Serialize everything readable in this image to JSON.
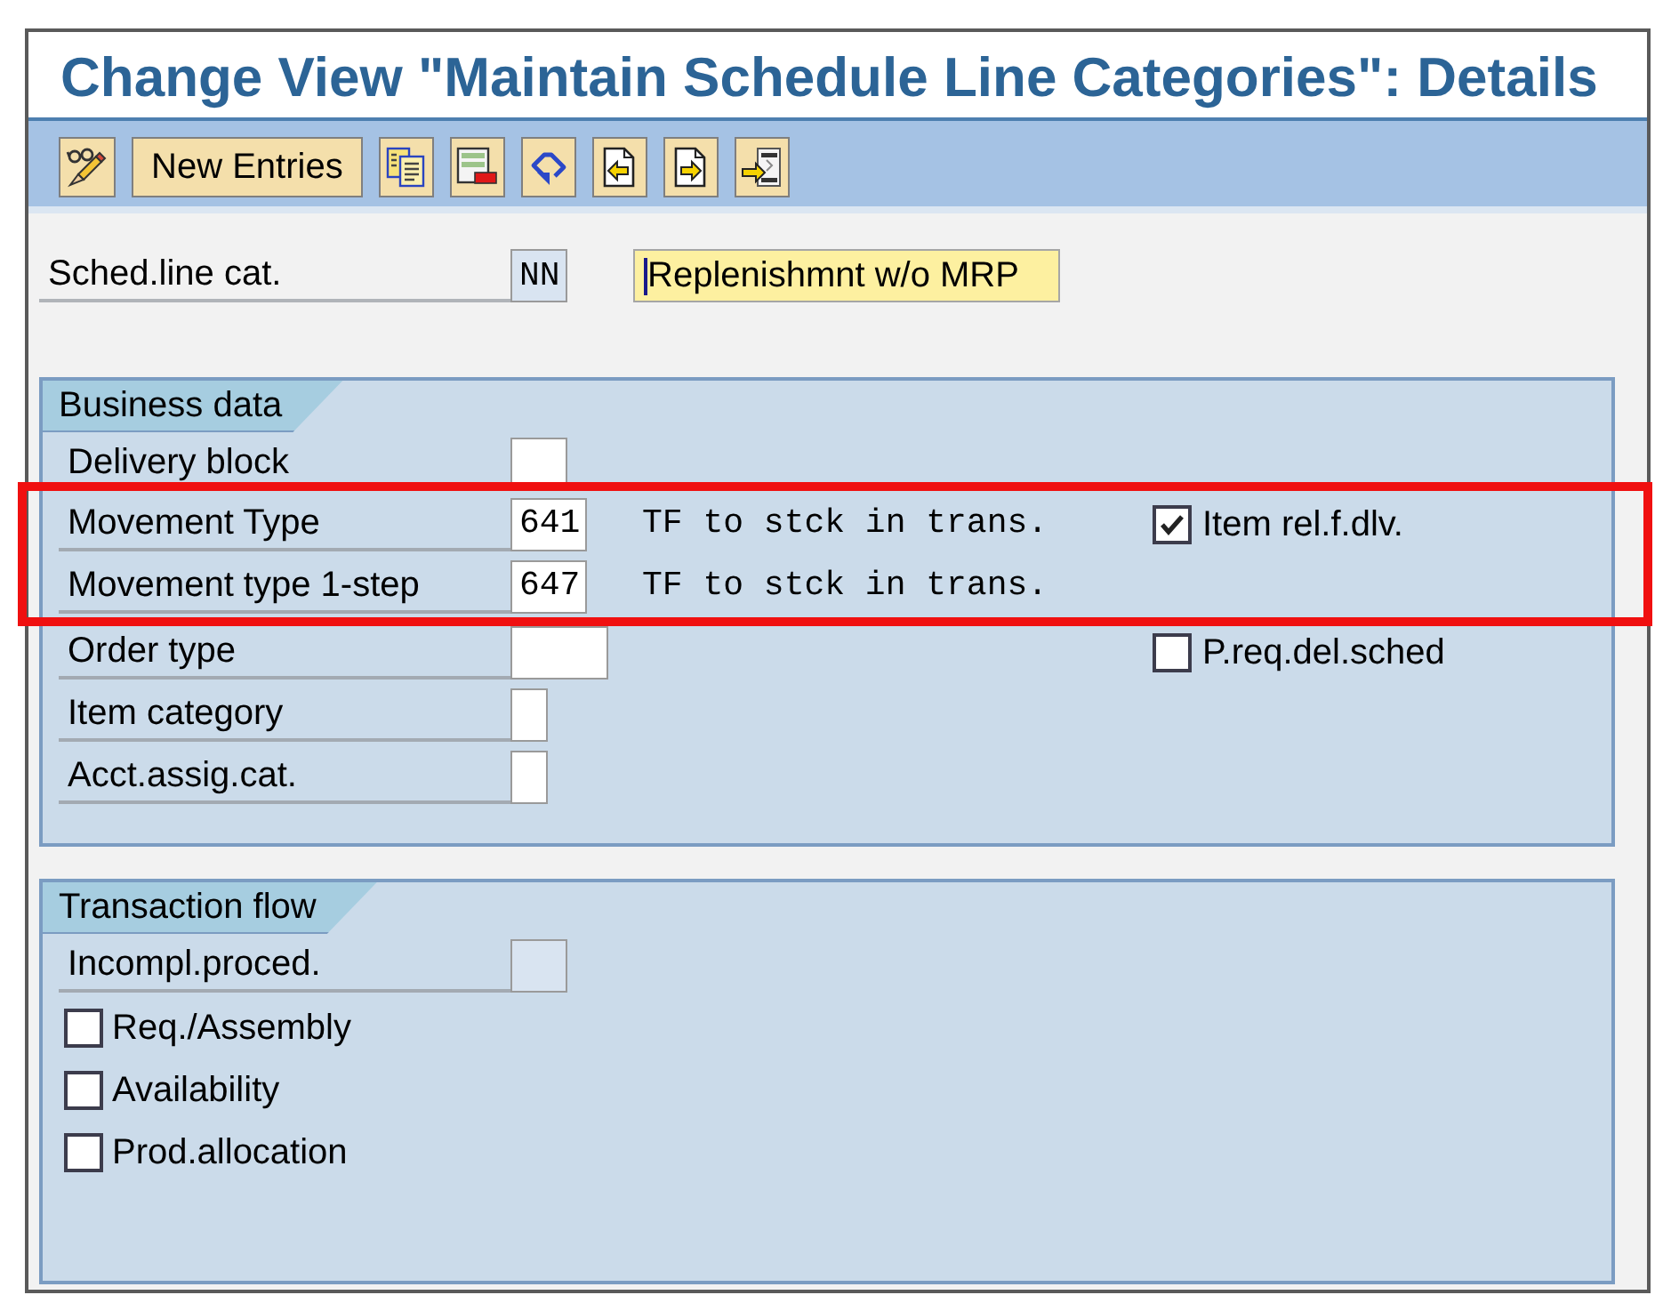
{
  "title": "Change View \"Maintain Schedule Line Categories\": Details",
  "toolbar": [
    {
      "kind": "icon"
    },
    {
      "kind": "text",
      "label": "New Entries"
    },
    {
      "kind": "icon"
    },
    {
      "kind": "icon"
    },
    {
      "kind": "icon"
    },
    {
      "kind": "icon"
    },
    {
      "kind": "icon"
    },
    {
      "kind": "icon"
    }
  ],
  "header_field": {
    "label": "Sched.line cat.",
    "value": "NN",
    "editable": false,
    "description": {
      "value": "Replenishmnt w/o MRP",
      "focused": true
    }
  },
  "groups": [
    {
      "title": "Business data",
      "rows": [
        {
          "kind": "field",
          "label": "Delivery block",
          "editable": true,
          "highlighted": false
        },
        {
          "kind": "field",
          "label": "Movement Type",
          "value": "641",
          "editable": true,
          "text": "TF to stck in trans.",
          "highlighted": true,
          "checkbox": {
            "label": "Item rel.f.dlv.",
            "checked": true
          }
        },
        {
          "kind": "field",
          "label": "Movement type 1-step",
          "value": "647",
          "editable": true,
          "text": "TF to stck in trans.",
          "highlighted": true
        },
        {
          "kind": "field",
          "label": "Order type",
          "editable": true,
          "highlighted": false,
          "checkbox": {
            "label": "P.req.del.sched",
            "checked": false
          }
        },
        {
          "kind": "field",
          "label": "Item category",
          "editable": true,
          "highlighted": false
        },
        {
          "kind": "field",
          "label": "Acct.assig.cat.",
          "editable": true,
          "highlighted": false
        }
      ]
    },
    {
      "title": "Transaction flow",
      "rows": [
        {
          "kind": "field",
          "label": "Incompl.proced.",
          "editable": false
        },
        {
          "kind": "checkbox",
          "label": "Req./Assembly",
          "checked": false
        },
        {
          "kind": "checkbox",
          "label": "Availability",
          "checked": false
        },
        {
          "kind": "checkbox",
          "label": "Prod.allocation",
          "checked": false
        }
      ]
    }
  ]
}
